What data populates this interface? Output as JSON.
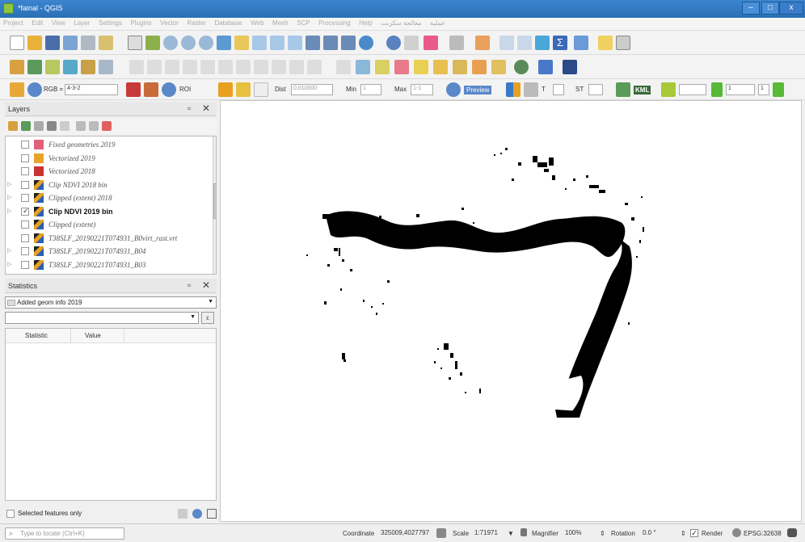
{
  "window": {
    "title": "*fainal - QGIS",
    "minimize": "–",
    "maximize": "□",
    "close": "x"
  },
  "menu": [
    "Project",
    "Edit",
    "View",
    "Layer",
    "Settings",
    "Plugins",
    "Vector",
    "Raster",
    "Database",
    "Web",
    "Mesh",
    "SCP",
    "Processing",
    "Help",
    "معالجة سكربت",
    "عملية"
  ],
  "toolbar3": {
    "rgb_label": "RGB =",
    "band_combo": "4-3-2",
    "roi_label": "ROI",
    "dist_label": "Dist",
    "dist_value": "0.010000",
    "min_label": "Min",
    "min_value": "1",
    "max_label": "Max",
    "max_value": "1-1",
    "preview_label": "Preview",
    "t_label": "T",
    "st_label": "ST",
    "kml_label": "KML",
    "field1": "1",
    "field2": "1"
  },
  "layers_panel": {
    "title": "Layers",
    "float_icon": "▫",
    "close_icon": "✕",
    "items": [
      {
        "label": "Fixed geometries 2019",
        "color": "#e0607a",
        "checked": false,
        "expandable": false,
        "raster": false,
        "bold": false
      },
      {
        "label": "Vectorized 2019",
        "color": "#e6a42a",
        "checked": false,
        "expandable": false,
        "raster": false,
        "bold": false
      },
      {
        "label": "Vectorized 2018",
        "color": "#c8332f",
        "checked": false,
        "expandable": false,
        "raster": false,
        "bold": false
      },
      {
        "label": "Clip NDVI 2018 bin",
        "color": "",
        "checked": false,
        "expandable": true,
        "raster": true,
        "bold": false
      },
      {
        "label": "Clipped (extent) 2018",
        "color": "",
        "checked": false,
        "expandable": true,
        "raster": true,
        "bold": false
      },
      {
        "label": "Clip NDVI 2019 bin",
        "color": "",
        "checked": true,
        "expandable": true,
        "raster": true,
        "bold": true
      },
      {
        "label": "Clipped (extent)",
        "color": "",
        "checked": false,
        "expandable": false,
        "raster": true,
        "bold": false
      },
      {
        "label": "T38SLF_20190221T074931_B0virt_rast.vrt",
        "color": "",
        "checked": false,
        "expandable": false,
        "raster": true,
        "bold": false
      },
      {
        "label": "T38SLF_20190221T074931_B04",
        "color": "",
        "checked": false,
        "expandable": true,
        "raster": true,
        "bold": false
      },
      {
        "label": "T38SLF_20190221T074931_B03",
        "color": "",
        "checked": false,
        "expandable": true,
        "raster": true,
        "bold": false
      }
    ]
  },
  "statistics_panel": {
    "title": "Statistics",
    "float_icon": "▫",
    "close_icon": "✕",
    "layer_combo": "Added geom info 2019",
    "field_combo": "",
    "columns": [
      "Statistic",
      "Value"
    ],
    "selected_only_label": "Selected features only"
  },
  "statusbar": {
    "locator_placeholder": "Type to locate (Ctrl+K)",
    "coordinate_label": "Coordinate",
    "coordinate_value": "325009,4027797",
    "scale_label": "Scale",
    "scale_value": "1:71971",
    "magnifier_label": "Magnifier",
    "magnifier_value": "100%",
    "rotation_label": "Rotation",
    "rotation_value": "0.0 °",
    "render_label": "Render",
    "crs_label": "EPSG:32638"
  }
}
